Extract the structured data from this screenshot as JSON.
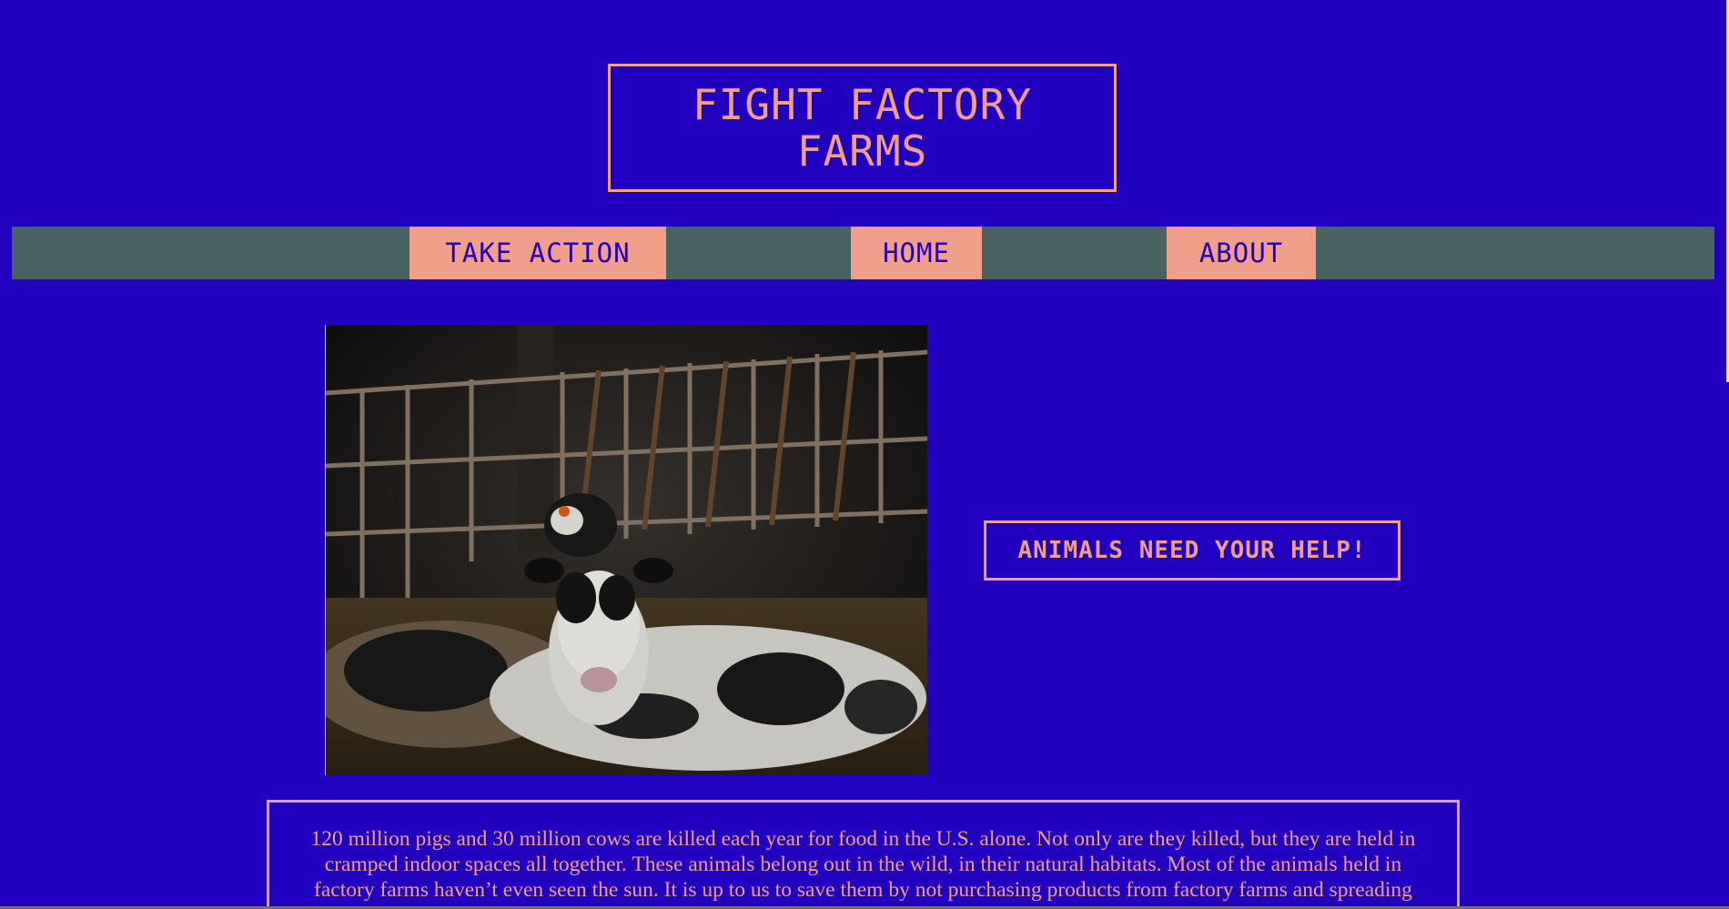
{
  "header": {
    "title": "FIGHT FACTORY FARMS"
  },
  "nav": {
    "items": [
      {
        "label": "TAKE ACTION"
      },
      {
        "label": "HOME"
      },
      {
        "label": "ABOUT"
      }
    ]
  },
  "hero": {
    "image_description_icon": "photo-of-calves-in-barn"
  },
  "callout": {
    "text": "ANIMALS NEED YOUR HELP!"
  },
  "info": {
    "paragraph": "120 million pigs and 30 million cows are killed each year for food in the U.S. alone. Not only are they killed, but they are held in cramped indoor spaces all together. These animals belong out in the wild, in their natural habitats. Most of the animals held in factory farms haven’t even seen the sun. It is up to us to save them by not purchasing products from factory farms and spreading awareness."
  },
  "colors": {
    "background": "#2200bf",
    "accent": "#f0a08a",
    "nav_bar": "#486262"
  }
}
